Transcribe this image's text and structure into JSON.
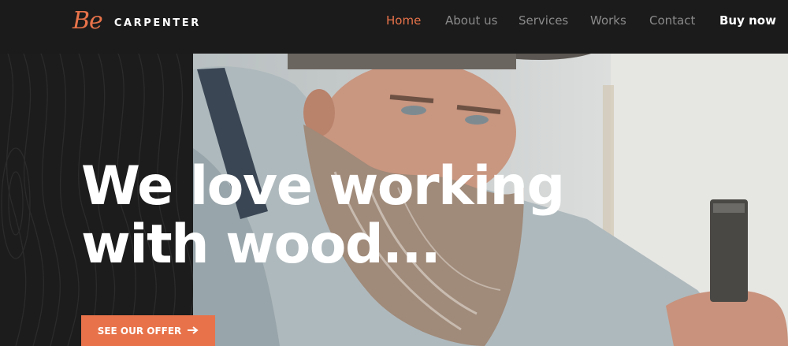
{
  "brand": {
    "mark": "Be",
    "name": "CARPENTER"
  },
  "nav": {
    "items": [
      {
        "label": "Home",
        "state": "active"
      },
      {
        "label": "About us"
      },
      {
        "label": "Services"
      },
      {
        "label": "Works"
      },
      {
        "label": "Contact"
      },
      {
        "label": "Buy now",
        "style": "emphasis"
      }
    ]
  },
  "hero": {
    "headline_line1": "We love working",
    "headline_line2": "with wood...",
    "cta_label": "SEE OUR OFFER",
    "cta_icon": "arrow-right-icon"
  },
  "colors": {
    "accent": "#e8734a",
    "header_bg": "#1b1b1b",
    "text_light": "#ffffff",
    "nav_muted": "#8a8a8a"
  }
}
